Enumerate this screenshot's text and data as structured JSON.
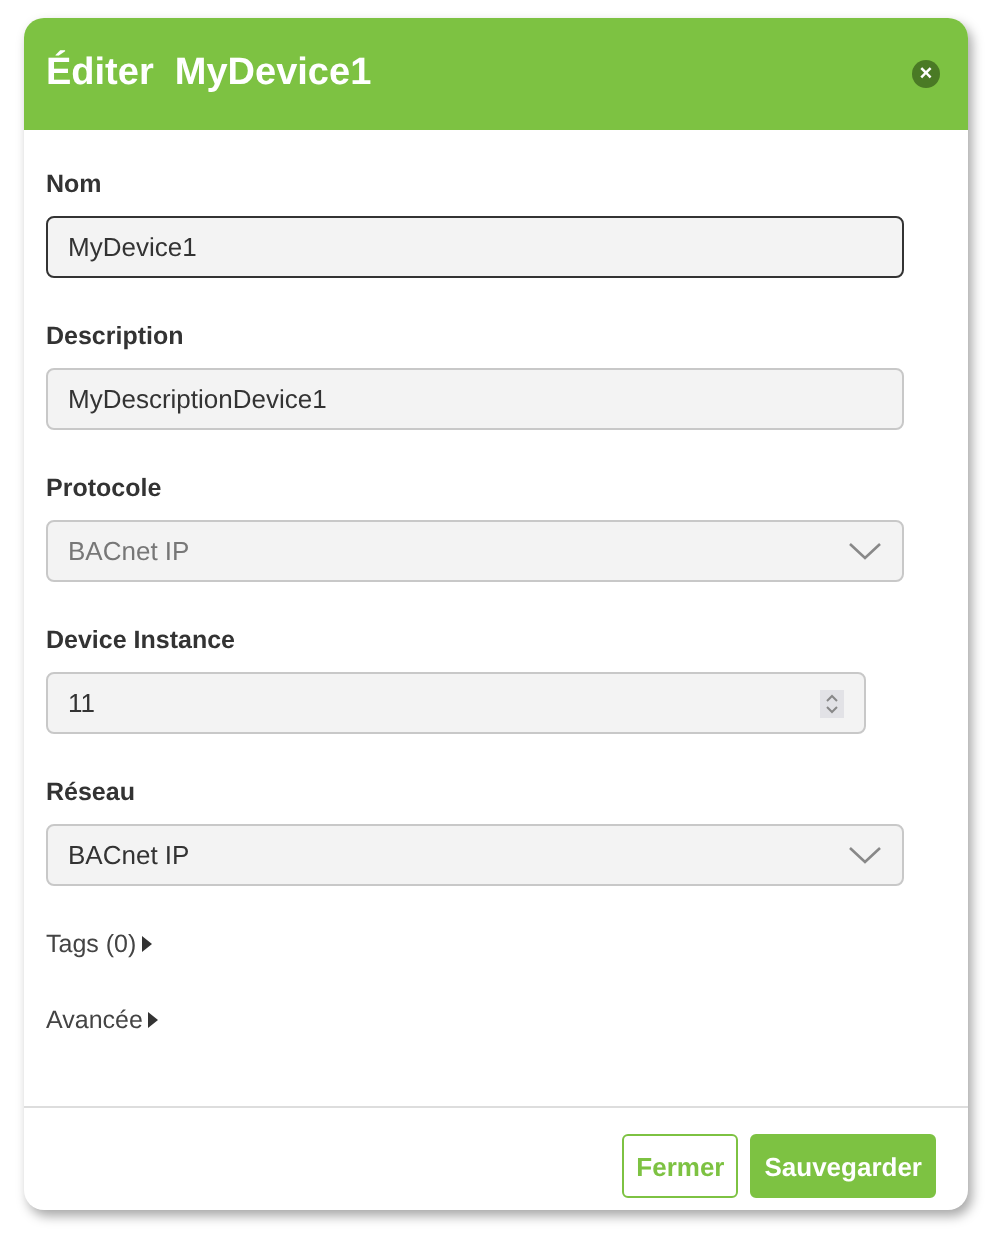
{
  "dialog": {
    "title": "Éditer  MyDevice1",
    "close": "×"
  },
  "fields": [
    {
      "kind": "text",
      "label": "Nom",
      "value": "MyDevice1",
      "focused": true,
      "disabled": false
    },
    {
      "kind": "text",
      "label": "Description",
      "value": "MyDescriptionDevice1",
      "focused": false,
      "disabled": false
    },
    {
      "kind": "select",
      "label": "Protocole",
      "value": "BACnet IP",
      "focused": false,
      "disabled": true
    },
    {
      "kind": "number",
      "label": "Device Instance",
      "value": "11",
      "focused": false,
      "disabled": false
    },
    {
      "kind": "select",
      "label": "Réseau",
      "value": "BACnet IP",
      "focused": false,
      "disabled": false
    }
  ],
  "sections": [
    {
      "label": "Tags (0)",
      "expanded": false
    },
    {
      "label": "Avancée",
      "expanded": false
    }
  ],
  "buttons": [
    {
      "label": "Fermer",
      "kind": "outline"
    },
    {
      "label": "Sauvegarder",
      "kind": "primary"
    }
  ]
}
